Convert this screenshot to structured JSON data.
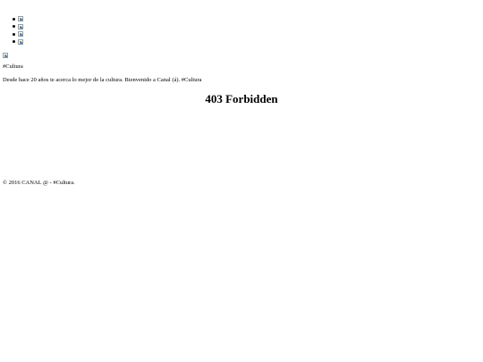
{
  "social_links": [
    {
      "icon": "image-placeholder-icon"
    },
    {
      "icon": "image-placeholder-icon"
    },
    {
      "icon": "image-placeholder-icon"
    },
    {
      "icon": "image-placeholder-icon"
    }
  ],
  "header": {
    "logo_icon": "image-placeholder-icon",
    "tagline": "#Cultura",
    "intro": "Desde hace 20 años te acerca lo mejor de la cultura. Bienvenido a Canal (á). #Cultura"
  },
  "main": {
    "error_title": "403 Forbidden"
  },
  "footer": {
    "copyright": "© 2016 CANAL @ - #Cultura."
  }
}
